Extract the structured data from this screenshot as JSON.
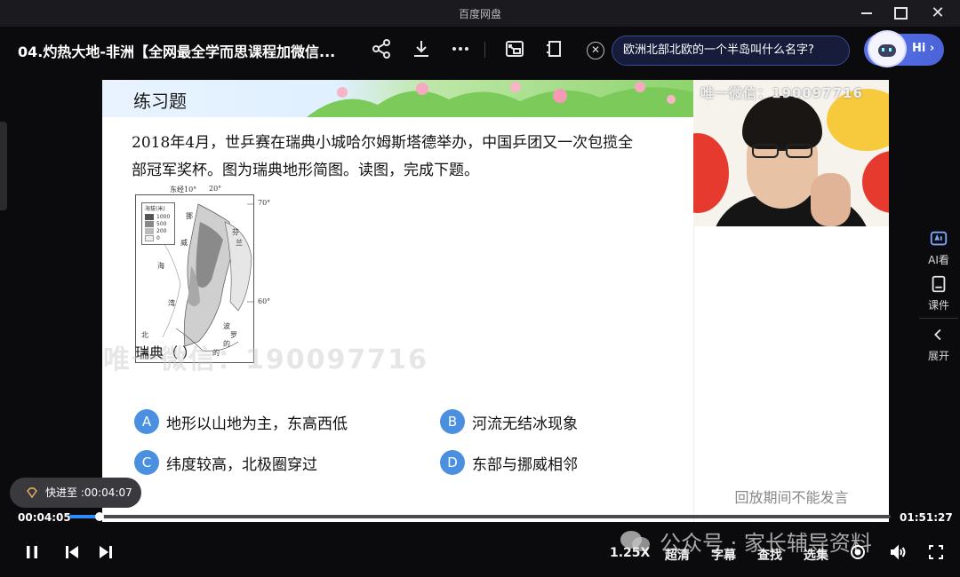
{
  "window": {
    "app_title": "百度网盘"
  },
  "header": {
    "video_title": "04.灼热大地-非洲【全网最全学而思课程加微信...",
    "question_prompt": "欧洲北部北欧的一个半岛叫什么名字?",
    "ai_button_label": "Hi"
  },
  "slide": {
    "banner_title": "练习题",
    "question_line1": "2018年4月，世乒赛在瑞典小城哈尔姆斯塔德举办，中国乒团又一次包揽全",
    "question_line2": "部冠军奖杯。图为瑞典地形简图。读图，完成下题。",
    "map": {
      "lon_label": "东经10°",
      "lon_label2": "20°",
      "lat_70": "70°",
      "lat_60": "60°",
      "legend_title": "海拔(米)",
      "legend_values": [
        "1000",
        "500",
        "200",
        "0"
      ],
      "place_labels": [
        "挪",
        "威",
        "海",
        "芬",
        "兰",
        "湾",
        "的",
        "北",
        "海",
        "波",
        "罗",
        "的"
      ]
    },
    "stem": "瑞典（      ）",
    "options": [
      {
        "letter": "A",
        "text": "地形以山地为主，东高西低"
      },
      {
        "letter": "B",
        "text": "河流无结冰现象"
      },
      {
        "letter": "C",
        "text": "纬度较高，北极圈穿过"
      },
      {
        "letter": "D",
        "text": "东部与挪威相邻"
      }
    ],
    "watermark": "唯一微信：190097716"
  },
  "camera": {
    "watermark": "唯一微信：190097716"
  },
  "chat": {
    "notice": "回放期间不能发言"
  },
  "right_rail": {
    "ai_watch": "AI看",
    "courseware": "课件",
    "expand": "展开"
  },
  "playback": {
    "seek_toast": "快进至 :00:04:07",
    "current_time": "00:04:05",
    "total_time": "01:51:27",
    "progress_fraction": 0.037,
    "speed": "1.25X",
    "quality": "超清",
    "subtitles": "字幕",
    "search": "查找",
    "episodes": "选集"
  },
  "overlay": {
    "wechat_watermark": "公众号 · 家长辅导资料"
  },
  "colors": {
    "accent": "#2f8cff",
    "option_badge": "#4a8fe0",
    "ai_button": "#5a72e8"
  }
}
